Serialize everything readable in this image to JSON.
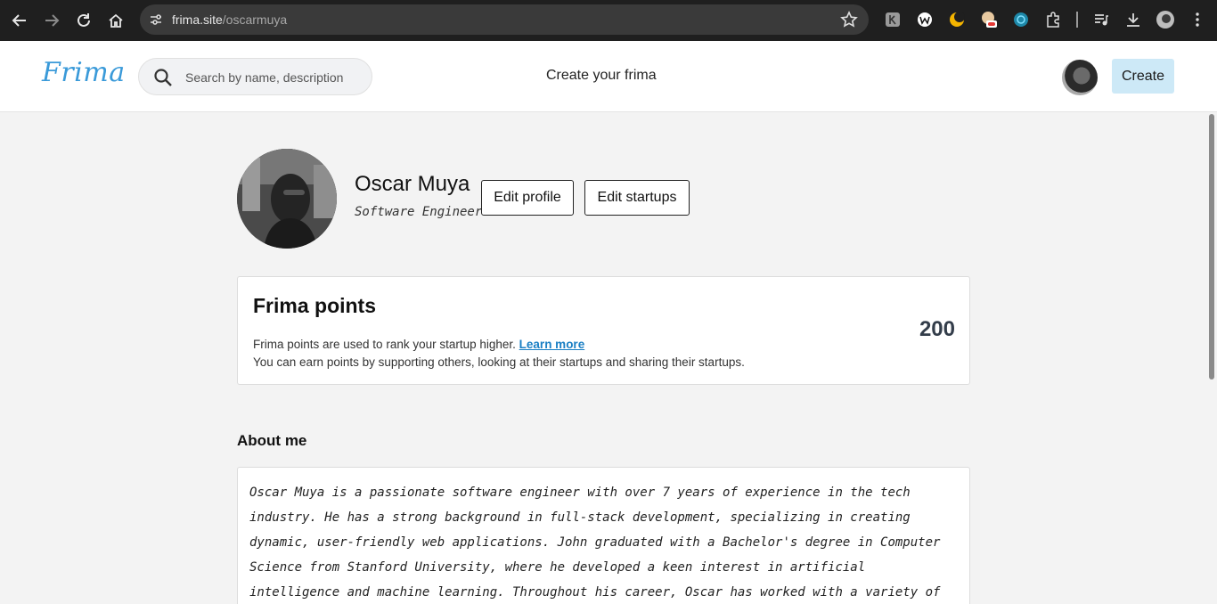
{
  "browser": {
    "url_domain": "frima.site",
    "url_path": "/oscarmuya"
  },
  "header": {
    "logo": "Frima",
    "search_placeholder": "Search by name, description",
    "center_link": "Create your frima",
    "create_label": "Create"
  },
  "profile": {
    "name": "Oscar Muya",
    "role": "Software Engineer",
    "edit_profile_label": "Edit profile",
    "edit_startups_label": "Edit startups"
  },
  "points": {
    "title": "Frima points",
    "desc_line1": "Frima points are used to rank your startup higher.",
    "learn_more": "Learn more",
    "desc_line2": "You can earn points by supporting others, looking at their startups and sharing their startups.",
    "value": "200"
  },
  "about": {
    "title": "About me",
    "text": "Oscar Muya is a passionate software engineer with over 7 years of experience in the tech industry. He has a strong background in full-stack development, specializing in creating dynamic, user-friendly web applications. John graduated with a Bachelor's degree in Computer Science from Stanford University, where he developed a keen interest in artificial intelligence and machine learning. Throughout his career, Oscar has worked with a variety of technologies, including JavaScript, TypeScript, React, Node.js, and Python."
  }
}
